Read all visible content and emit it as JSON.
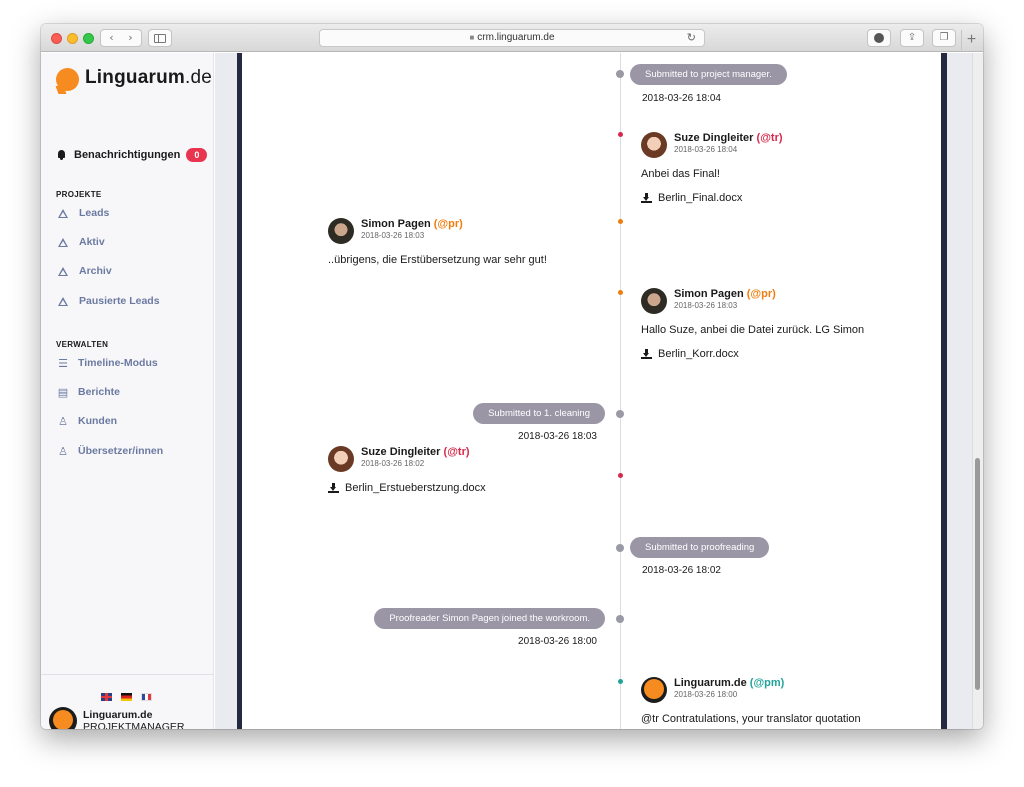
{
  "browser": {
    "url": "crm.linguarum.de"
  },
  "sidebar": {
    "logo": {
      "name": "Linguarum",
      "tld": ".de"
    },
    "notifications": {
      "label": "Benachrichtigungen",
      "count": "0"
    },
    "sections": {
      "projects": "PROJEKTE",
      "manage": "VERWALTEN"
    },
    "project_items": [
      {
        "label": "Leads",
        "icon": "triangle-icon"
      },
      {
        "label": "Aktiv",
        "icon": "triangle-icon"
      },
      {
        "label": "Archiv",
        "icon": "triangle-icon"
      },
      {
        "label": "Pausierte Leads",
        "icon": "triangle-icon"
      }
    ],
    "manage_items": [
      {
        "label": "Timeline-Modus",
        "icon": "sliders-icon"
      },
      {
        "label": "Berichte",
        "icon": "document-icon"
      },
      {
        "label": "Kunden",
        "icon": "user-icon"
      },
      {
        "label": "Übersetzer/innen",
        "icon": "user-icon"
      }
    ],
    "languages": [
      "en",
      "de",
      "fr"
    ],
    "user": {
      "name": "Linguarum.de",
      "role": "PROJEKTMANAGER"
    }
  },
  "timeline": {
    "colors": {
      "tr": "#d8284a",
      "pr": "#f07d10",
      "pm": "#21a39a",
      "pill": "#9a96a6"
    },
    "events": [
      {
        "type": "status",
        "side": "right",
        "label": "Submitted to project manager.",
        "time": "2018-03-26 18:04"
      },
      {
        "type": "message",
        "side": "right",
        "author": "Suze Dingleiter",
        "role": "(@tr)",
        "time": "2018-03-26 18:04",
        "text": "Anbei das Final!",
        "attachment": "Berlin_Final.docx"
      },
      {
        "type": "message",
        "side": "left",
        "author": "Simon Pagen",
        "role": "(@pr)",
        "time": "2018-03-26 18:03",
        "text": "..übrigens, die Erstübersetzung war sehr gut!"
      },
      {
        "type": "message",
        "side": "right",
        "author": "Simon Pagen",
        "role": "(@pr)",
        "time": "2018-03-26 18:03",
        "text": "Hallo Suze, anbei die Datei zurück. LG Simon",
        "attachment": "Berlin_Korr.docx"
      },
      {
        "type": "status",
        "side": "left",
        "label": "Submitted to 1. cleaning",
        "time": "2018-03-26 18:03"
      },
      {
        "type": "message",
        "side": "left",
        "author": "Suze Dingleiter",
        "role": "(@tr)",
        "time": "2018-03-26 18:02",
        "attachment": "Berlin_Erstueberstzung.docx"
      },
      {
        "type": "status",
        "side": "right",
        "label": "Submitted to proofreading",
        "time": "2018-03-26 18:02"
      },
      {
        "type": "status",
        "side": "left",
        "label": "Proofreader Simon Pagen joined the workroom.",
        "time": "2018-03-26 18:00"
      },
      {
        "type": "message",
        "side": "right",
        "author": "Linguarum.de",
        "role": "(@pm)",
        "time": "2018-03-26 18:00",
        "text": "@tr Contratulations, your translator quotation accepted!"
      }
    ]
  }
}
